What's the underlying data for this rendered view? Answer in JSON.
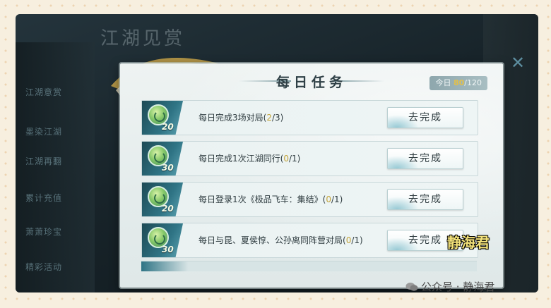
{
  "background": {
    "title": "江湖见赏",
    "menu": [
      "江湖意赏",
      "墨染江湖",
      "江湖再翻",
      "累计充值",
      "萧萧珍宝",
      "精彩活动"
    ]
  },
  "dialog": {
    "title": "每日任务",
    "today_label": "今日",
    "today_current": "80",
    "today_total": "/120"
  },
  "tasks": [
    {
      "reward": "20",
      "text": "每日完成3场对局(",
      "cur": "2",
      "rest": "/3)",
      "button": "去完成"
    },
    {
      "reward": "30",
      "text": "每日完成1次江湖同行(",
      "cur": "0",
      "rest": "/1)",
      "button": "去完成"
    },
    {
      "reward": "20",
      "text": "每日登录1次《极品飞车：集结》(",
      "cur": "0",
      "rest": "/1)",
      "button": "去完成"
    },
    {
      "reward": "30",
      "text": "每日与昆、夏侯惇、公孙离同阵营对局(",
      "cur": "0",
      "rest": "/1)",
      "button": "去完成"
    }
  ],
  "watermark": "静海君",
  "footer": "公众号 · 静海君",
  "colors": {
    "accent_gold": "#c2a339",
    "teal": "#2f7485",
    "watermark": "#f3e27a"
  }
}
